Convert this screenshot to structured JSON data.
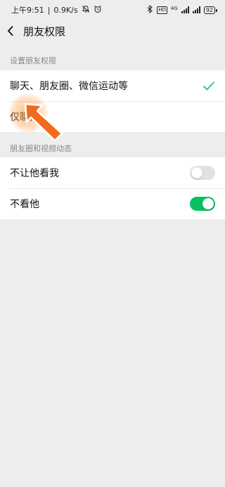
{
  "status_bar": {
    "time": "上午9:51",
    "network_speed": "0.9K/s",
    "battery": "92",
    "network_type": "4G",
    "hd_badge": "HD",
    "icons": [
      "alarm-off-icon",
      "bluetooth-icon",
      "signal-icon",
      "battery-icon"
    ]
  },
  "nav": {
    "title": "朋友权限"
  },
  "section_permissions": {
    "header": "设置朋友权限",
    "options": [
      {
        "label": "聊天、朋友圈、微信运动等",
        "selected": true
      },
      {
        "label": "仅聊天",
        "selected": false
      }
    ]
  },
  "section_moments": {
    "header": "朋友圈和视频动态",
    "items": [
      {
        "label": "不让他看我",
        "enabled": false
      },
      {
        "label": "不看他",
        "enabled": true
      }
    ]
  },
  "colors": {
    "accent": "#07c160",
    "background": "#ededed",
    "card": "#ffffff",
    "hint_arrow": "#f26b1d"
  }
}
